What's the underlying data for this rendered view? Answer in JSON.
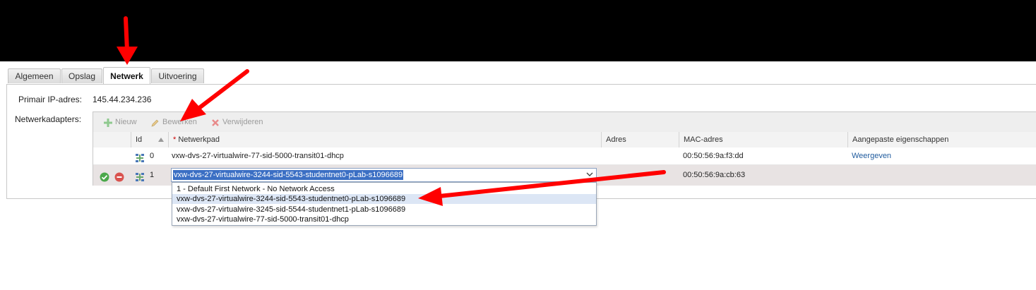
{
  "tabs": [
    {
      "label": "Algemeen"
    },
    {
      "label": "Opslag"
    },
    {
      "label": "Netwerk"
    },
    {
      "label": "Uitvoering"
    }
  ],
  "active_tab": "Netwerk",
  "primary_ip": {
    "label": "Primair IP-adres:",
    "value": "145.44.234.236"
  },
  "adapters_label": "Netwerkadapters:",
  "toolbar": {
    "new_label": "Nieuw",
    "edit_label": "Bewerken",
    "delete_label": "Verwijderen"
  },
  "columns": {
    "id": "Id",
    "network_path_required": "*",
    "network_path": "Netwerkpad",
    "address": "Adres",
    "mac": "MAC-adres",
    "custom_props": "Aangepaste eigenschappen"
  },
  "rows": [
    {
      "id": "0",
      "network_path": "vxw-dvs-27-virtualwire-77-sid-5000-transit01-dhcp",
      "address": "",
      "mac": "00:50:56:9a:f3:dd",
      "custom_props": "Weergeven"
    },
    {
      "id": "1",
      "network_path": "vxw-dvs-27-virtualwire-3244-sid-5543-studentnet0-pLab-s1096689",
      "address": "",
      "mac": "00:50:56:9a:cb:63",
      "custom_props": ""
    }
  ],
  "dropdown_options": [
    {
      "label": "1 - Default First Network - No Network Access"
    },
    {
      "label": "vxw-dvs-27-virtualwire-3244-sid-5543-studentnet0-pLab-s1096689"
    },
    {
      "label": "vxw-dvs-27-virtualwire-3245-sid-5544-studentnet1-pLab-s1096689"
    },
    {
      "label": "vxw-dvs-27-virtualwire-77-sid-5000-transit01-dhcp"
    }
  ],
  "colors": {
    "arrow": "#ff0000",
    "top_bar": "#000000",
    "selection": "#3b6fc4",
    "link": "#1f5b9e"
  },
  "icons": [
    "plus-icon",
    "pencil-icon",
    "delete-x-icon",
    "sort-up-icon",
    "network-icon",
    "accept-icon",
    "cancel-icon",
    "chevron-down-icon"
  ]
}
